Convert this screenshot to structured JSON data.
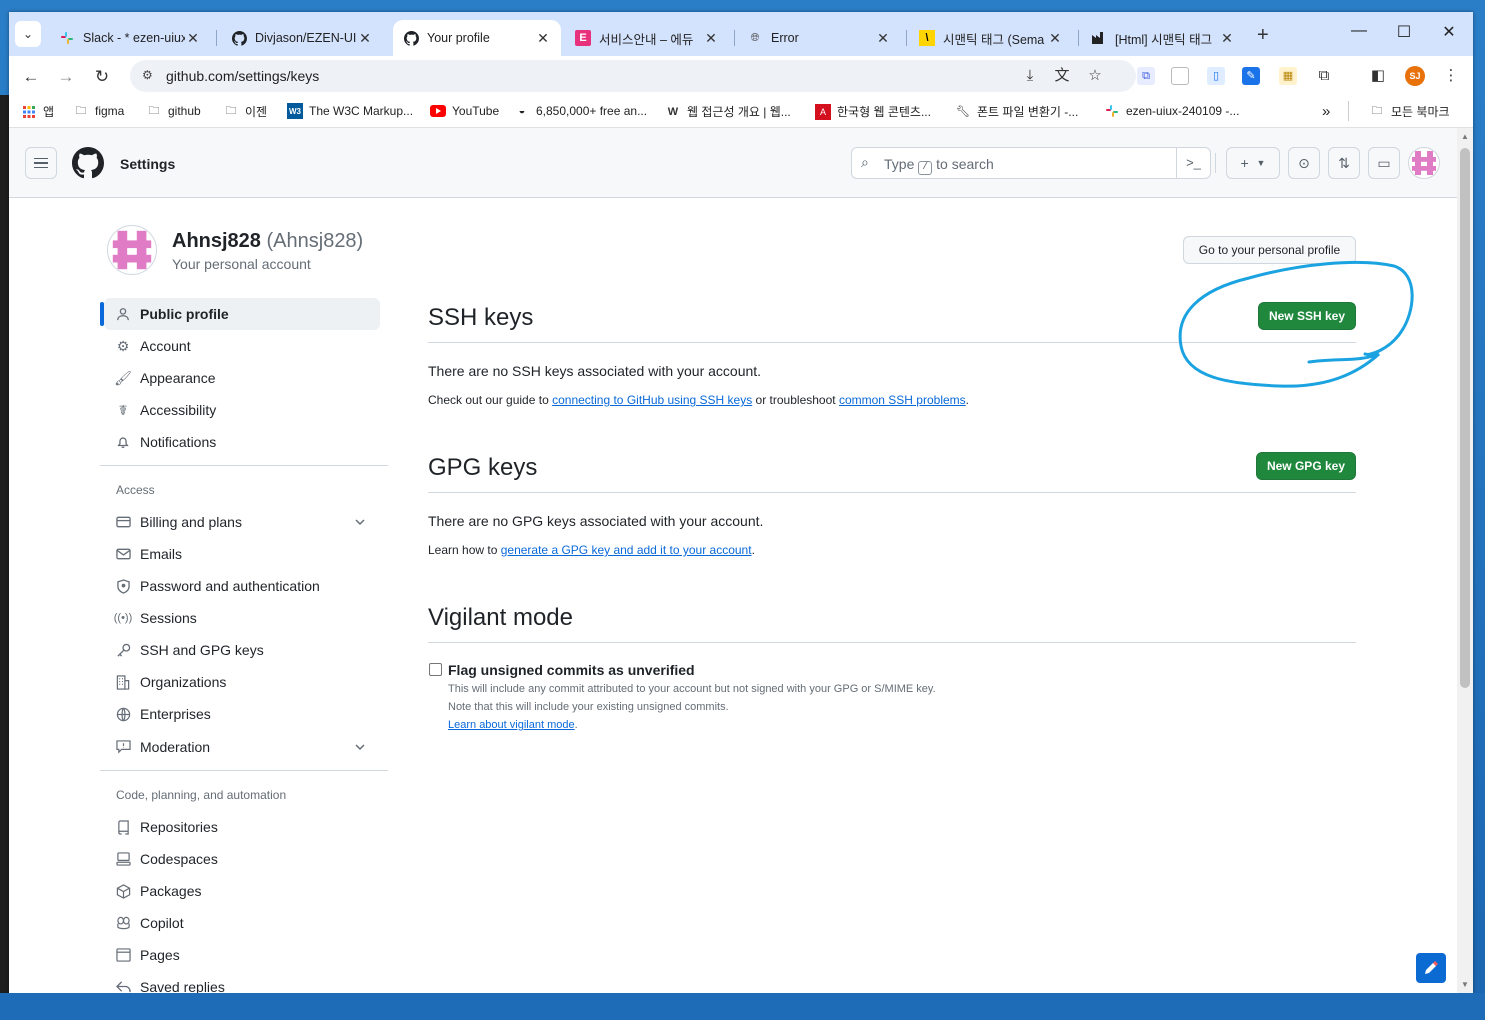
{
  "browser": {
    "tabs": [
      {
        "title": "Slack - * ezen-uiux",
        "icon": "slack-icon"
      },
      {
        "title": "Divjason/EZEN-UIUX",
        "icon": "github-icon"
      },
      {
        "title": "Your profile",
        "icon": "github-icon",
        "active": true
      },
      {
        "title": "서비스안내 – 에듀",
        "icon": "e-icon"
      },
      {
        "title": "Error",
        "icon": "globe-icon"
      },
      {
        "title": "시맨틱 태그 (Sema",
        "icon": "yellow-slash-icon"
      },
      {
        "title": "[Html] 시맨틱 태그",
        "icon": "factory-icon"
      }
    ],
    "url": "github.com/settings/keys",
    "profile_initials": "SJ",
    "bookmarks": [
      {
        "label": "앱",
        "icon": "apps-grid-icon"
      },
      {
        "label": "figma",
        "icon": "folder-icon"
      },
      {
        "label": "github",
        "icon": "folder-icon"
      },
      {
        "label": "이젠",
        "icon": "folder-icon"
      },
      {
        "label": "The W3C Markup...",
        "icon": "w3c-icon"
      },
      {
        "label": "YouTube",
        "icon": "youtube-icon"
      },
      {
        "label": "6,850,000+ free an...",
        "icon": "bowl-icon"
      },
      {
        "label": "웹 접근성 개요 | 웹...",
        "icon": "w-icon"
      },
      {
        "label": "한국형 웹 콘텐츠...",
        "icon": "pdf-icon"
      },
      {
        "label": "폰트 파일 변환기 -...",
        "icon": "wrench-icon"
      },
      {
        "label": "ezen-uiux-240109 -...",
        "icon": "slack-icon"
      }
    ],
    "overflow": "»",
    "all_bookmarks": "모든 북마크"
  },
  "github": {
    "header_title": "Settings",
    "search_prefix": "Type",
    "search_key": "/",
    "search_suffix": "to search"
  },
  "profile": {
    "name": "Ahnsj828",
    "login": "(Ahnsj828)",
    "subtitle": "Your personal account",
    "goto_button": "Go to your personal profile"
  },
  "sidebar": {
    "top_items": [
      {
        "label": "Public profile",
        "icon": "person-icon",
        "selected": true
      },
      {
        "label": "Account",
        "icon": "gear-icon"
      },
      {
        "label": "Appearance",
        "icon": "paintbrush-icon"
      },
      {
        "label": "Accessibility",
        "icon": "accessibility-icon"
      },
      {
        "label": "Notifications",
        "icon": "bell-icon"
      }
    ],
    "access_heading": "Access",
    "access_items": [
      {
        "label": "Billing and plans",
        "icon": "credit-card-icon",
        "expandable": true
      },
      {
        "label": "Emails",
        "icon": "mail-icon"
      },
      {
        "label": "Password and authentication",
        "icon": "shield-lock-icon"
      },
      {
        "label": "Sessions",
        "icon": "broadcast-icon"
      },
      {
        "label": "SSH and GPG keys",
        "icon": "key-icon"
      },
      {
        "label": "Organizations",
        "icon": "organization-icon"
      },
      {
        "label": "Enterprises",
        "icon": "globe-icon"
      },
      {
        "label": "Moderation",
        "icon": "report-icon",
        "expandable": true
      }
    ],
    "code_heading": "Code, planning, and automation",
    "code_items": [
      {
        "label": "Repositories",
        "icon": "repo-icon"
      },
      {
        "label": "Codespaces",
        "icon": "codespaces-icon"
      },
      {
        "label": "Packages",
        "icon": "package-icon"
      },
      {
        "label": "Copilot",
        "icon": "copilot-icon"
      },
      {
        "label": "Pages",
        "icon": "browser-icon"
      },
      {
        "label": "Saved replies",
        "icon": "reply-icon"
      }
    ]
  },
  "ssh": {
    "heading": "SSH keys",
    "button": "New SSH key",
    "empty": "There are no SSH keys associated with your account.",
    "guide_prefix": "Check out our guide to",
    "guide_link": "connecting to GitHub using SSH keys",
    "guide_mid": "or troubleshoot",
    "guide_link2": "common SSH problems",
    "guide_end": "."
  },
  "gpg": {
    "heading": "GPG keys",
    "button": "New GPG key",
    "empty": "There are no GPG keys associated with your account.",
    "learn_prefix": "Learn how to",
    "learn_link": "generate a GPG key and add it to your account",
    "learn_end": "."
  },
  "vigilant": {
    "heading": "Vigilant mode",
    "checkbox_label": "Flag unsigned commits as unverified",
    "checked": false,
    "note1": "This will include any commit attributed to your account but not signed with your GPG or S/MIME key.",
    "note2": "Note that this will include your existing unsigned commits.",
    "link": "Learn about vigilant mode",
    "link_end": "."
  },
  "colors": {
    "accent": "#0969da",
    "primary_button": "#1f883d",
    "annotation": "#1aa3e0"
  }
}
